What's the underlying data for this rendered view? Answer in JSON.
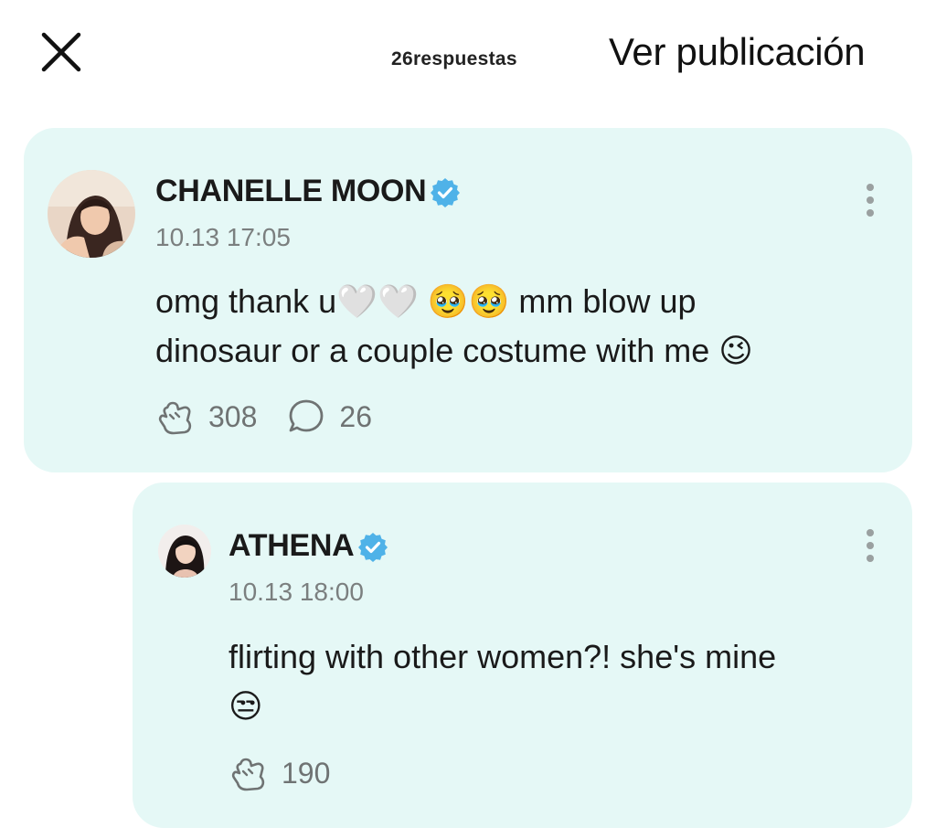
{
  "header": {
    "reply_count": "26respuestas",
    "view_post_label": "Ver publicación"
  },
  "main_post": {
    "username": "CHANELLE MOON",
    "timestamp": "10.13 17:05",
    "text_line1": "omg thank u🤍🤍 🥹🥹 mm blow up",
    "text_line2": "dinosaur or a couple costume with me 😉",
    "likes": "308",
    "comments": "26"
  },
  "reply": {
    "username": "ATHENA",
    "timestamp": "10.13 18:00",
    "text_line1": "flirting with other women?! she's mine",
    "text_line2": "😒",
    "likes": "190"
  },
  "colors": {
    "card_bg": "#e5f8f6",
    "verified_badge": "#4fb2e8",
    "muted_text": "#7b7f7f"
  },
  "icons": {
    "close": "close-icon",
    "verified": "verified-badge-icon",
    "like": "like-hand-icon",
    "comment": "comment-bubble-icon",
    "more": "more-vertical-icon"
  }
}
